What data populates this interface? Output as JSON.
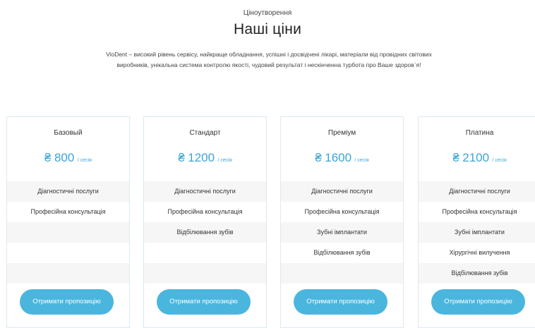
{
  "section": {
    "eyebrow": "Ціноутворення",
    "title": "Наші ціни",
    "description": "VioDent – високий рівень сервісу, найкраще обладнання, успішні і досвідчені лікарі, матеріали від провідних світових виробників, унікальна система контролю якості, чудовий результат і нескінченна турбота про Ваше здоров`я!"
  },
  "currency_symbol": "₴",
  "per_label": "/ сесія",
  "cta_label": "Отримати пропозицію",
  "plans": [
    {
      "name": "Базовый",
      "price": "800",
      "features": [
        "Діагностичні послуги",
        "Професійна консультація",
        "",
        "",
        "",
        ""
      ]
    },
    {
      "name": "Стандарт",
      "price": "1200",
      "features": [
        "Діагностичні послуги",
        "Професійна консультація",
        "Відбілювання зубів",
        "",
        "",
        ""
      ]
    },
    {
      "name": "Преміум",
      "price": "1600",
      "features": [
        "Діагностичні послуги",
        "Професійна консультація",
        "Зубні імплантати",
        "Відбілювання зубів",
        "",
        ""
      ]
    },
    {
      "name": "Платина",
      "price": "2100",
      "features": [
        "Діагностичні послуги",
        "Професійна консультація",
        "Зубні імплантати",
        "Хірургічні вилучення",
        "Відбілювання зубів",
        ""
      ]
    }
  ],
  "colors": {
    "accent": "#4ab6de",
    "price": "#3aa5d6",
    "row_alt": "#f6f6f6",
    "card_border": "#dde9ef"
  }
}
